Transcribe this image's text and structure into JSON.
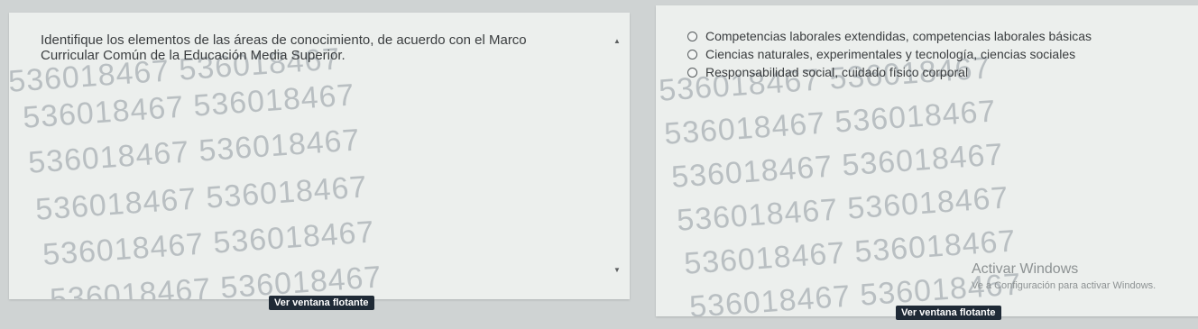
{
  "left": {
    "question": "Identifique los elementos de las áreas de conocimiento, de acuerdo con el Marco Curricular Común de la Educación Media Superior.",
    "watermark": "536018467 536018467",
    "float_button": "Ver ventana flotante"
  },
  "right": {
    "options": [
      "Competencias laborales extendidas, competencias laborales básicas",
      "Ciencias naturales, experimentales y tecnología, ciencias sociales",
      "Responsabilidad social, cuidado físico corporal"
    ],
    "watermark": "536018467 536018467",
    "activate_title": "Activar Windows",
    "activate_subtitle": "Ve a Configuración para activar Windows.",
    "float_button": "Ver ventana flotante"
  }
}
